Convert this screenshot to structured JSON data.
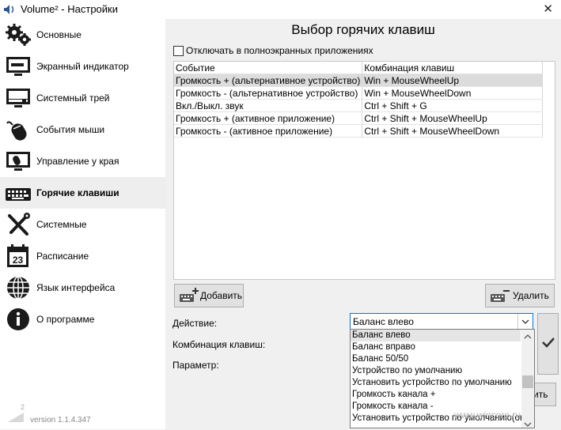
{
  "window": {
    "title": "Volume² - Настройки",
    "close_glyph": "✕"
  },
  "sidebar": {
    "items": [
      {
        "label": "Основные",
        "icon": "gears-icon"
      },
      {
        "label": "Экранный индикатор",
        "icon": "monitor-icon"
      },
      {
        "label": "Системный трей",
        "icon": "tray-icon"
      },
      {
        "label": "События мыши",
        "icon": "mouse-icon"
      },
      {
        "label": "Управление у края",
        "icon": "screen-edge-icon"
      },
      {
        "label": "Горячие клавиши",
        "icon": "keyboard-icon",
        "active": true
      },
      {
        "label": "Системные",
        "icon": "tools-icon"
      },
      {
        "label": "Расписание",
        "icon": "calendar-icon",
        "calendar_day": "23"
      },
      {
        "label": "Язык интерфейса",
        "icon": "globe-icon"
      },
      {
        "label": "О программе",
        "icon": "info-icon"
      }
    ],
    "version": "version 1.1.4.347",
    "version_logo_mark": "2"
  },
  "main": {
    "title": "Выбор горячих клавиш",
    "checkbox_label": "Отключать в полноэкранных приложениях",
    "table": {
      "headers": [
        "Событие",
        "Комбинация клавиш"
      ],
      "rows": [
        [
          "Громкость + (альтернативное устройство)",
          "Win + MouseWheelUp"
        ],
        [
          "Громкость - (альтернативное устройство)",
          "Win + MouseWheelDown"
        ],
        [
          "Вкл./Выкл. звук",
          "Ctrl + Shift + G"
        ],
        [
          "Громкость + (активное приложение)",
          "Ctrl + Shift + MouseWheelUp"
        ],
        [
          "Громкость - (активное приложение)",
          "Ctrl + Shift + MouseWheelDown"
        ]
      ],
      "selected_row": 0
    },
    "add_button": "Добавить",
    "delete_button": "Удалить",
    "action_label": "Действие:",
    "combo_label": "Комбинация клавиш:",
    "param_label": "Параметр:",
    "action_value": "Баланс влево",
    "dropdown_options": [
      "Баланс влево",
      "Баланс вправо",
      "Баланс 50/50",
      "Устройство по умолчанию",
      "Установить устройство по умолчанию",
      "Громкость канала +",
      "Громкость канала -",
      "Установить устройство по умолчанию(ок"
    ],
    "hidden_button_text": "ить"
  },
  "watermark": "www.wincore.ru",
  "colors": {
    "accent": "#0078d7",
    "icon_dark": "#1a1a1a",
    "selected_row": "#dcdcdc"
  }
}
